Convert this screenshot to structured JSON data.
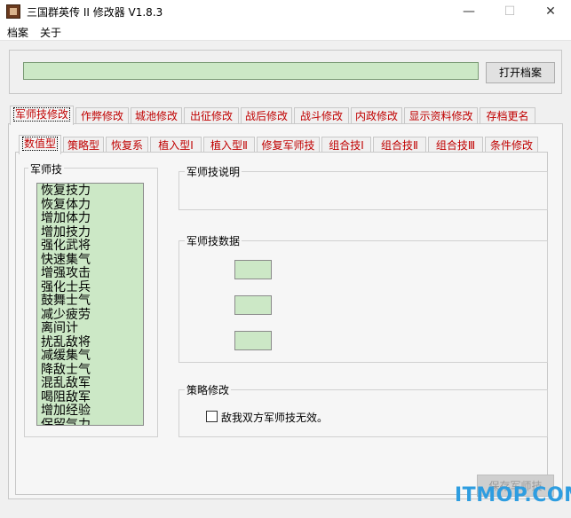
{
  "window": {
    "title": "三国群英传 II 修改器 V1.8.3",
    "controls": {
      "minimize": "—",
      "maximize": "☐",
      "close": "✕"
    }
  },
  "menu": {
    "items": [
      "档案",
      "关于"
    ]
  },
  "top": {
    "open_button": "打开档案",
    "path_value": ""
  },
  "main_tabs": [
    "军师技修改",
    "作弊修改",
    "城池修改",
    "出征修改",
    "战后修改",
    "战斗修改",
    "内政修改",
    "显示资料修改",
    "存档更名"
  ],
  "sub_tabs": [
    "数值型",
    "策略型",
    "恢复系",
    "植入型Ⅰ",
    "植入型Ⅱ",
    "修复军师技",
    "组合技Ⅰ",
    "组合技Ⅱ",
    "组合技Ⅲ",
    "条件修改"
  ],
  "skills": {
    "title": "军师技",
    "items": [
      "恢复技力",
      "恢复体力",
      "增加体力",
      "增加技力",
      "强化武将",
      "快速集气",
      "增强攻击",
      "强化士兵",
      "鼓舞士气",
      "减少疲劳",
      "离间计",
      "扰乱敌将",
      "减缓集气",
      "降敌士气",
      "混乱敌军",
      "喝阻敌军",
      "增加经验",
      "保留气力"
    ]
  },
  "description": {
    "title": "军师技说明"
  },
  "skill_data": {
    "title": "军师技数据"
  },
  "strategy": {
    "title": "策略修改",
    "checkbox_label": "敌我双方军师技无效。"
  },
  "save_button": "保存军师技",
  "watermark": "ITMOP.COM"
}
